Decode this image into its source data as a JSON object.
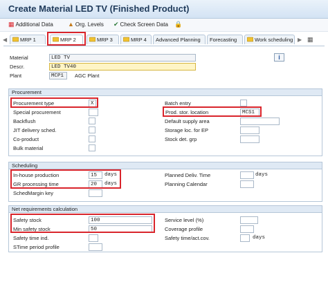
{
  "window": {
    "title": "Create Material LED TV (Finished Product)"
  },
  "toolbar": {
    "additional_data": "Additional Data",
    "org_levels": "Org. Levels",
    "check_screen_data": "Check Screen Data"
  },
  "tabs": [
    {
      "label": "MRP 1"
    },
    {
      "label": "MRP 2"
    },
    {
      "label": "MRP 3"
    },
    {
      "label": "MRP 4"
    },
    {
      "label": "Advanced Planning"
    },
    {
      "label": "Forecasting"
    },
    {
      "label": "Work scheduling"
    }
  ],
  "header": {
    "material_label": "Material",
    "material_value": "LED TV",
    "descr_label": "Descr.",
    "descr_value": "LED TV40",
    "plant_label": "Plant",
    "plant_code": "MCP1",
    "plant_name": "AGC Plant"
  },
  "procurement": {
    "title": "Procurement",
    "procurement_type_label": "Procurement type",
    "procurement_type_value": "X",
    "special_procurement_label": "Special procurement",
    "backflush_label": "Backflush",
    "jit_label": "JIT delivery sched.",
    "coproduct_label": "Co-product",
    "bulk_material_label": "Bulk material",
    "batch_entry_label": "Batch entry",
    "prod_stor_location_label": "Prod. stor. location",
    "prod_stor_location_value": "MCS1",
    "default_supply_area_label": "Default supply area",
    "storage_loc_ep_label": "Storage loc. for EP",
    "stock_det_grp_label": "Stock det. grp"
  },
  "scheduling": {
    "title": "Scheduling",
    "inhouse_production_label": "In-house production",
    "inhouse_production_value": "15",
    "gr_processing_time_label": "GR processing time",
    "gr_processing_time_value": "20",
    "schedmargin_key_label": "SchedMargin key",
    "planned_deliv_time_label": "Planned Deliv. Time",
    "planning_calendar_label": "Planning Calendar",
    "days_unit": "days"
  },
  "net_requirements": {
    "title": "Net requirements calculation",
    "safety_stock_label": "Safety stock",
    "safety_stock_value": "100",
    "min_safety_stock_label": "Min safety stock",
    "min_safety_stock_value": "50",
    "safety_time_ind_label": "Safety time ind.",
    "stime_period_profile_label": "STime period profile",
    "service_level_label": "Service level (%)",
    "coverage_profile_label": "Coverage profile",
    "safety_time_actcov_label": "Safety time/act.cov.",
    "days_unit": "days"
  },
  "icons": {
    "info": "i"
  },
  "colors": {
    "highlight_red": "#d9242b",
    "title_text": "#1f3a5a",
    "group_header": "#dfe9f4"
  }
}
